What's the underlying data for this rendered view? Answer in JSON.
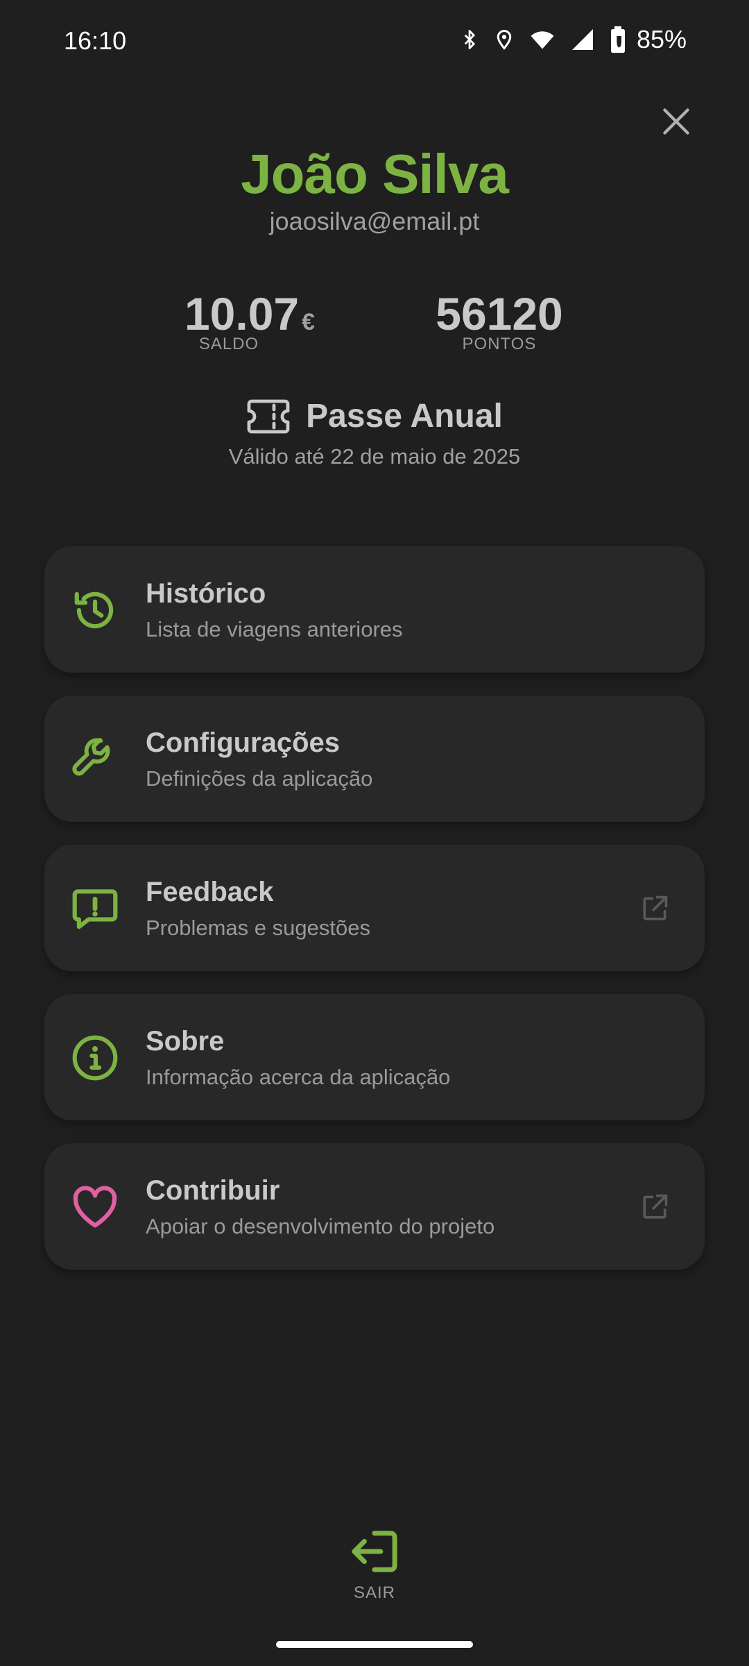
{
  "status_bar": {
    "time": "16:10",
    "battery": "85%",
    "icons": [
      "bluetooth-icon",
      "location-icon",
      "wifi-icon",
      "signal-icon",
      "battery-icon"
    ]
  },
  "profile": {
    "name": "João Silva",
    "email": "joaosilva@email.pt"
  },
  "stats": {
    "balance": {
      "value": "10.07",
      "unit": "€",
      "label": "SALDO"
    },
    "points": {
      "value": "56120",
      "label": "PONTOS"
    }
  },
  "pass": {
    "title": "Passe Anual",
    "validity": "Válido até 22 de maio de 2025"
  },
  "menu": {
    "items": [
      {
        "title": "Histórico",
        "subtitle": "Lista de viagens anteriores",
        "icon": "history-icon",
        "external": false
      },
      {
        "title": "Configurações",
        "subtitle": "Definições da aplicação",
        "icon": "wrench-icon",
        "external": false
      },
      {
        "title": "Feedback",
        "subtitle": "Problemas e sugestões",
        "icon": "feedback-icon",
        "external": true
      },
      {
        "title": "Sobre",
        "subtitle": "Informação acerca da aplicação",
        "icon": "info-icon",
        "external": false
      },
      {
        "title": "Contribuir",
        "subtitle": "Apoiar o desenvolvimento do projeto",
        "icon": "heart-icon",
        "external": true
      }
    ]
  },
  "logout": {
    "label": "SAIR"
  },
  "colors": {
    "background": "#1f1f1f",
    "card": "#282828",
    "accent_green": "#7cb342",
    "accent_pink": "#e060a0",
    "text_primary": "#c9c9c9",
    "text_secondary": "#9a9a9a"
  }
}
